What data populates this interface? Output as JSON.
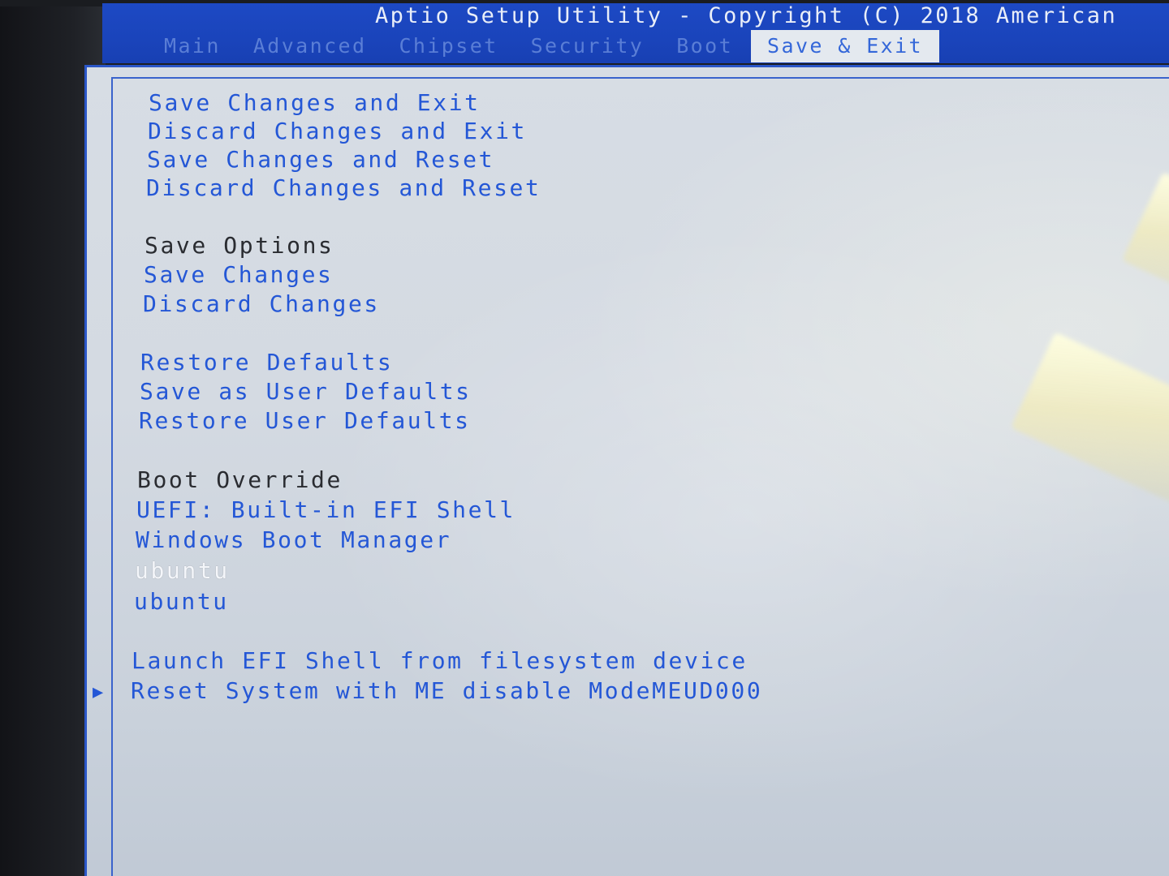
{
  "header": {
    "title": "Aptio Setup Utility - Copyright (C) 2018 American",
    "tabs": [
      {
        "label": "Main"
      },
      {
        "label": "Advanced"
      },
      {
        "label": "Chipset"
      },
      {
        "label": "Security"
      },
      {
        "label": "Boot"
      },
      {
        "label": "Save & Exit",
        "active": true
      }
    ]
  },
  "menu": {
    "exit_items": [
      "Save Changes and Exit",
      "Discard Changes and Exit",
      "Save Changes and Reset",
      "Discard Changes and Reset"
    ],
    "save_options_heading": "Save Options",
    "save_options": [
      "Save Changes",
      "Discard Changes"
    ],
    "defaults": [
      "Restore Defaults",
      "Save as User Defaults",
      "Restore User Defaults"
    ],
    "boot_override_heading": "Boot Override",
    "boot_override": [
      "UEFI: Built-in EFI Shell",
      "Windows Boot Manager",
      "ubuntu",
      "ubuntu"
    ],
    "selected_item": "ubuntu",
    "extra": [
      "Launch EFI Shell from filesystem device",
      "Reset System with ME disable ModeMEUD000"
    ],
    "submenu_pointer_icon": "right-triangle-icon"
  },
  "colors": {
    "header_bg": "#1a44bb",
    "panel_bg": "#d7dde4",
    "item_text": "#2457d6",
    "heading_text": "#2a2c31",
    "selected_text": "#f4f6fa"
  }
}
